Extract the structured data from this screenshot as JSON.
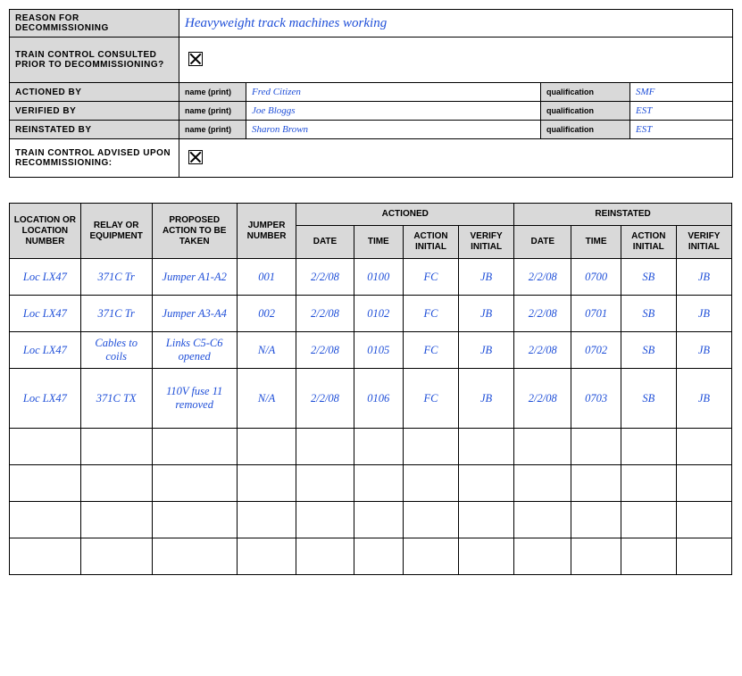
{
  "header": {
    "reason_label": "Reason for decommissioning",
    "reason_value": "Heavyweight track machines working",
    "consulted_label": "Train control consulted prior to decommissioning?",
    "consulted_checked": true,
    "actioned_by_label": "Actioned by",
    "verified_by_label": "Verified by",
    "reinstated_by_label": "Reinstated by",
    "name_print_label": "name (print)",
    "qualification_label": "qualification",
    "actioned_by_name": "Fred Citizen",
    "actioned_by_qual": "SMF",
    "verified_by_name": "Joe Bloggs",
    "verified_by_qual": "EST",
    "reinstated_by_name": "Sharon Brown",
    "reinstated_by_qual": "EST",
    "advised_label": "Train control advised upon recommissioning:",
    "advised_checked": true
  },
  "grid_headers": {
    "location": "LOCATION OR LOCATION NUMBER",
    "relay": "RELAY OR EQUIPMENT",
    "action": "PROPOSED ACTION TO BE TAKEN",
    "jumper": "JUMPER NUMBER",
    "actioned": "ACTIONED",
    "reinstated": "REINSTATED",
    "date": "DATE",
    "time": "TIME",
    "action_initial": "ACTION INITIAL",
    "verify_initial": "VERIFY INITIAL"
  },
  "rows": [
    {
      "loc": "Loc LX47",
      "relay": "371C Tr",
      "action": "Jumper A1-A2",
      "jumper": "001",
      "a_date": "2/2/08",
      "a_time": "0100",
      "a_ai": "FC",
      "a_vi": "JB",
      "r_date": "2/2/08",
      "r_time": "0700",
      "r_ai": "SB",
      "r_vi": "JB"
    },
    {
      "loc": "Loc LX47",
      "relay": "371C Tr",
      "action": "Jumper A3-A4",
      "jumper": "002",
      "a_date": "2/2/08",
      "a_time": "0102",
      "a_ai": "FC",
      "a_vi": "JB",
      "r_date": "2/2/08",
      "r_time": "0701",
      "r_ai": "SB",
      "r_vi": "JB"
    },
    {
      "loc": "Loc LX47",
      "relay": "Cables to coils",
      "action": "Links C5-C6 opened",
      "jumper": "N/A",
      "a_date": "2/2/08",
      "a_time": "0105",
      "a_ai": "FC",
      "a_vi": "JB",
      "r_date": "2/2/08",
      "r_time": "0702",
      "r_ai": "SB",
      "r_vi": "JB"
    },
    {
      "loc": "Loc LX47",
      "relay": "371C TX",
      "action": "110V fuse 11 removed",
      "jumper": "N/A",
      "a_date": "2/2/08",
      "a_time": "0106",
      "a_ai": "FC",
      "a_vi": "JB",
      "r_date": "2/2/08",
      "r_time": "0703",
      "r_ai": "SB",
      "r_vi": "JB"
    },
    {
      "loc": "",
      "relay": "",
      "action": "",
      "jumper": "",
      "a_date": "",
      "a_time": "",
      "a_ai": "",
      "a_vi": "",
      "r_date": "",
      "r_time": "",
      "r_ai": "",
      "r_vi": ""
    },
    {
      "loc": "",
      "relay": "",
      "action": "",
      "jumper": "",
      "a_date": "",
      "a_time": "",
      "a_ai": "",
      "a_vi": "",
      "r_date": "",
      "r_time": "",
      "r_ai": "",
      "r_vi": ""
    },
    {
      "loc": "",
      "relay": "",
      "action": "",
      "jumper": "",
      "a_date": "",
      "a_time": "",
      "a_ai": "",
      "a_vi": "",
      "r_date": "",
      "r_time": "",
      "r_ai": "",
      "r_vi": ""
    },
    {
      "loc": "",
      "relay": "",
      "action": "",
      "jumper": "",
      "a_date": "",
      "a_time": "",
      "a_ai": "",
      "a_vi": "",
      "r_date": "",
      "r_time": "",
      "r_ai": "",
      "r_vi": ""
    }
  ]
}
